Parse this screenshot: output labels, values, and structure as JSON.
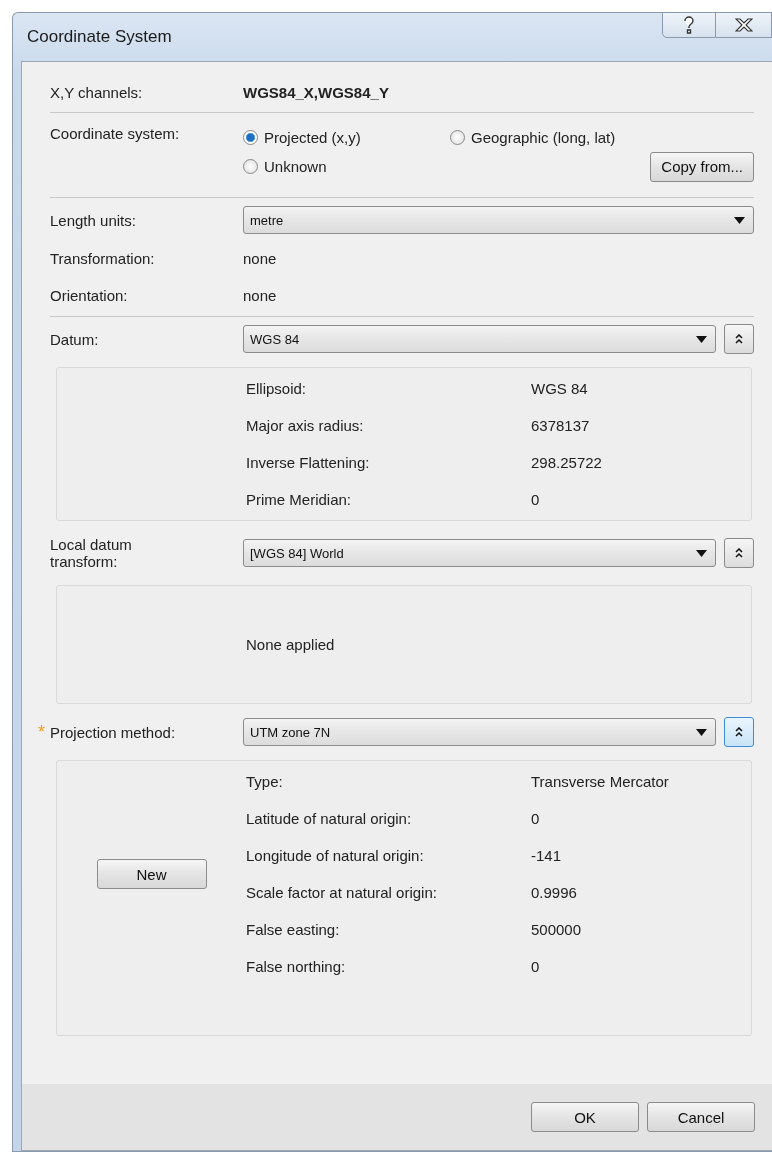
{
  "window": {
    "title": "Coordinate System"
  },
  "channels": {
    "label": "X,Y channels:",
    "value": "WGS84_X,WGS84_Y"
  },
  "coordinate_system": {
    "label": "Coordinate system:",
    "options": [
      {
        "label": "Projected (x,y)",
        "selected": true
      },
      {
        "label": "Geographic (long, lat)",
        "selected": false
      },
      {
        "label": "Unknown",
        "selected": false
      }
    ],
    "copy_button": "Copy from..."
  },
  "length_units": {
    "label": "Length units:",
    "value": "metre"
  },
  "transformation": {
    "label": "Transformation:",
    "value": "none"
  },
  "orientation": {
    "label": "Orientation:",
    "value": "none"
  },
  "datum": {
    "label": "Datum:",
    "value": "WGS 84",
    "expanded": true,
    "focused": false,
    "details": [
      {
        "label": "Ellipsoid:",
        "value": "WGS 84"
      },
      {
        "label": "Major axis radius:",
        "value": "6378137"
      },
      {
        "label": "Inverse Flattening:",
        "value": "298.25722"
      },
      {
        "label": "Prime Meridian:",
        "value": "0"
      }
    ]
  },
  "local_datum_transform": {
    "label": "Local datum transform:",
    "value": "[WGS 84] World",
    "expanded": true,
    "focused": false,
    "note": "None applied"
  },
  "projection_method": {
    "marker": "*",
    "label": "Projection method:",
    "value": "UTM zone 7N",
    "expanded": true,
    "focused": true,
    "new_button": "New",
    "details": [
      {
        "label": "Type:",
        "value": "Transverse Mercator"
      },
      {
        "label": "Latitude of natural origin:",
        "value": "0"
      },
      {
        "label": "Longitude of natural origin:",
        "value": "-141"
      },
      {
        "label": "Scale factor at natural origin:",
        "value": "0.9996"
      },
      {
        "label": "False easting:",
        "value": "500000"
      },
      {
        "label": "False northing:",
        "value": "0"
      }
    ]
  },
  "buttons": [
    {
      "label": "OK"
    },
    {
      "label": "Cancel"
    }
  ]
}
